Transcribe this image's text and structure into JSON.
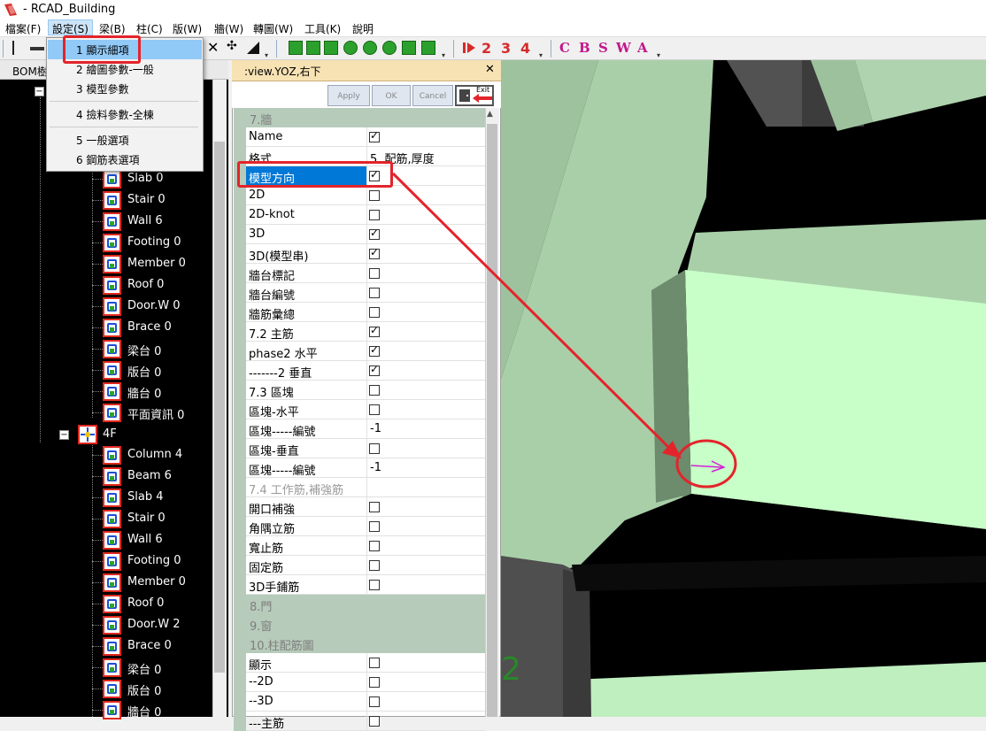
{
  "window": {
    "title": "- RCAD_Building"
  },
  "menu": [
    {
      "label": "檔案(F)"
    },
    {
      "label": "設定(S)"
    },
    {
      "label": "梁(B)"
    },
    {
      "label": "柱(C)"
    },
    {
      "label": "版(W)"
    },
    {
      "label": "牆(W)"
    },
    {
      "label": "轉圖(W)"
    },
    {
      "label": "工具(K)"
    },
    {
      "label": "說明"
    }
  ],
  "toolbar": {
    "numbers": [
      "2",
      "3",
      "4"
    ],
    "letters": [
      "C",
      "B",
      "S",
      "W",
      "A"
    ]
  },
  "dropdown": [
    {
      "label": "1 顯示細項"
    },
    {
      "label": "2 繪圖參數-一般"
    },
    {
      "label": "3 模型參數"
    },
    {
      "label": "4 撿料參數-全棟"
    },
    {
      "label": "5 一般選項"
    },
    {
      "label": "6 鋼筋表選項"
    }
  ],
  "tree": {
    "header": "BOM樹",
    "floor_items_top": [
      "Slab 0",
      "Stair 0",
      "Wall 6",
      "Footing 0",
      "Member 0",
      "Roof 0",
      "Door.W 0",
      "Brace 0",
      "梁台 0",
      "版台 0",
      "牆台 0",
      "平面資訊 0"
    ],
    "floor_4f": "4F",
    "floor_items_4f": [
      "Column 4",
      "Beam 6",
      "Slab 4",
      "Stair 0",
      "Wall 6",
      "Footing 0",
      "Member 0",
      "Roof 0",
      "Door.W 2",
      "Brace 0",
      "梁台 0",
      "版台 0",
      "牆台 0"
    ]
  },
  "props_panel": {
    "title": ":view.YOZ,右下",
    "close": "✕",
    "buttons": {
      "apply": "Apply",
      "ok": "OK",
      "cancel": "Cancel",
      "exit": "Exit"
    },
    "rows": [
      {
        "type": "cat",
        "name": "7.牆"
      },
      {
        "type": "check",
        "name": "Name",
        "checked": true
      },
      {
        "type": "text",
        "name": "格式",
        "value": "5. 配筋,厚度"
      },
      {
        "type": "check",
        "name": "模型方向",
        "checked": true,
        "selected": true
      },
      {
        "type": "check",
        "name": "2D",
        "checked": false
      },
      {
        "type": "check",
        "name": "2D-knot",
        "checked": false
      },
      {
        "type": "check",
        "name": "3D",
        "checked": true
      },
      {
        "type": "check",
        "name": "3D(模型串)",
        "checked": true
      },
      {
        "type": "check",
        "name": "牆台標記",
        "checked": false
      },
      {
        "type": "check",
        "name": "牆台編號",
        "checked": false
      },
      {
        "type": "check",
        "name": "牆筋彙總",
        "checked": false
      },
      {
        "type": "check",
        "name": "7.2 主筋",
        "checked": true
      },
      {
        "type": "check",
        "name": "phase2 水平",
        "checked": true
      },
      {
        "type": "check",
        "name": "-------2 垂直",
        "checked": true
      },
      {
        "type": "check",
        "name": "7.3 區塊",
        "checked": false
      },
      {
        "type": "check",
        "name": "區塊-水平",
        "checked": false
      },
      {
        "type": "text",
        "name": "區塊-----編號",
        "value": "-1"
      },
      {
        "type": "check",
        "name": "區塊-垂直",
        "checked": false
      },
      {
        "type": "text",
        "name": "區塊-----編號",
        "value": "-1"
      },
      {
        "type": "sub",
        "name": "7.4 工作筋,補強筋"
      },
      {
        "type": "check",
        "name": "開口補強",
        "checked": false
      },
      {
        "type": "check",
        "name": "角隅立筋",
        "checked": false
      },
      {
        "type": "check",
        "name": "寬止筋",
        "checked": false
      },
      {
        "type": "check",
        "name": "固定筋",
        "checked": false
      },
      {
        "type": "check",
        "name": "3D手鋪筋",
        "checked": false
      },
      {
        "type": "cat",
        "name": "8.門"
      },
      {
        "type": "cat",
        "name": "9.窗"
      },
      {
        "type": "cat",
        "name": "10.柱配筋圖"
      },
      {
        "type": "check",
        "name": "顯示",
        "checked": false
      },
      {
        "type": "check",
        "name": "--2D",
        "checked": false
      },
      {
        "type": "check",
        "name": "--3D",
        "checked": false
      },
      {
        "type": "check",
        "name": "---主筋",
        "checked": false
      }
    ]
  },
  "colors": {
    "panel_header": "#f7e2b4",
    "category_bg": "#b7cbba",
    "selection": "#0078d7",
    "highlight_red": "#e3242b",
    "model_light": "#c8ffc8",
    "model_mid": "#9ec89e",
    "model_dark": "#5a7a5a"
  }
}
